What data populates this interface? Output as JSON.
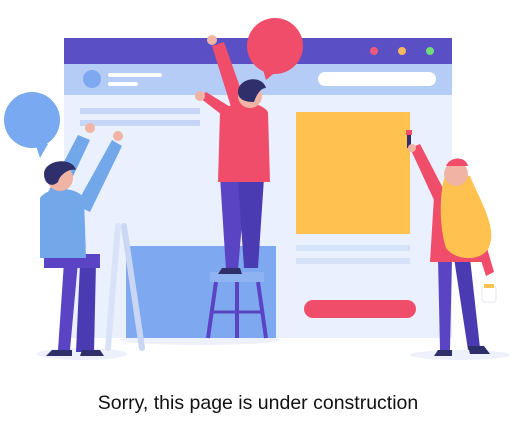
{
  "message": {
    "text": "Sorry, this page is under construction"
  },
  "illustration": {
    "name": "under-construction-illustration",
    "icons": [
      "speech-bubble-icon",
      "speech-bubble-icon",
      "browser-window-icon",
      "ladder-icon",
      "stool-icon",
      "paint-brush-icon",
      "mug-icon"
    ]
  },
  "colors": {
    "window_header": "#5a4fc4",
    "window_toolbar": "#b5cdf6",
    "window_body": "#e6ecfc",
    "window_body_light": "#eff3fd",
    "address_bar": "#ffffff",
    "dot_red": "#f05a7a",
    "dot_yellow": "#f4b860",
    "dot_green": "#6fdc7a",
    "accent_red": "#f04d6b",
    "blue_bubble": "#79a9f0",
    "yellow_block": "#ffc24f",
    "blue_panel": "#7ea8ef",
    "purple_clothes": "#5a44c4",
    "dark_hair": "#2e2f6b",
    "caption_text": "#111111"
  }
}
